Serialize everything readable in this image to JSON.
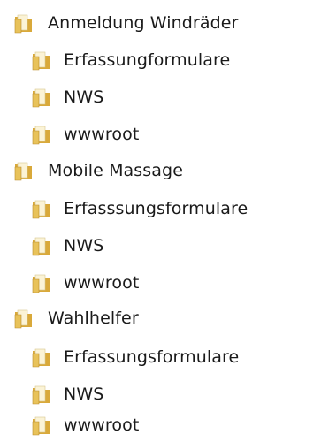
{
  "tree": {
    "groups": [
      {
        "label": "Anmeldung Windräder",
        "icon": "folder-icon",
        "children": [
          {
            "label": "Erfassungformulare",
            "icon": "folder-icon"
          },
          {
            "label": "NWS",
            "icon": "folder-icon"
          },
          {
            "label": "wwwroot",
            "icon": "folder-icon"
          }
        ]
      },
      {
        "label": "Mobile Massage",
        "icon": "folder-icon",
        "children": [
          {
            "label": "Erfasssungsformulare",
            "icon": "folder-icon"
          },
          {
            "label": "NWS",
            "icon": "folder-icon"
          },
          {
            "label": "wwwroot",
            "icon": "folder-icon"
          }
        ]
      },
      {
        "label": "Wahlhelfer",
        "icon": "folder-icon",
        "children": [
          {
            "label": "Erfassungsformulare",
            "icon": "folder-icon"
          },
          {
            "label": "NWS",
            "icon": "folder-icon"
          },
          {
            "label": "wwwroot",
            "icon": "folder-icon"
          }
        ]
      }
    ]
  },
  "colors": {
    "folder_body": "#e8c25a",
    "folder_back": "#d9a93a",
    "folder_paper": "#fbf3d6",
    "folder_shadow": "#b98a28",
    "text": "#1a1a1a",
    "background": "#ffffff"
  }
}
